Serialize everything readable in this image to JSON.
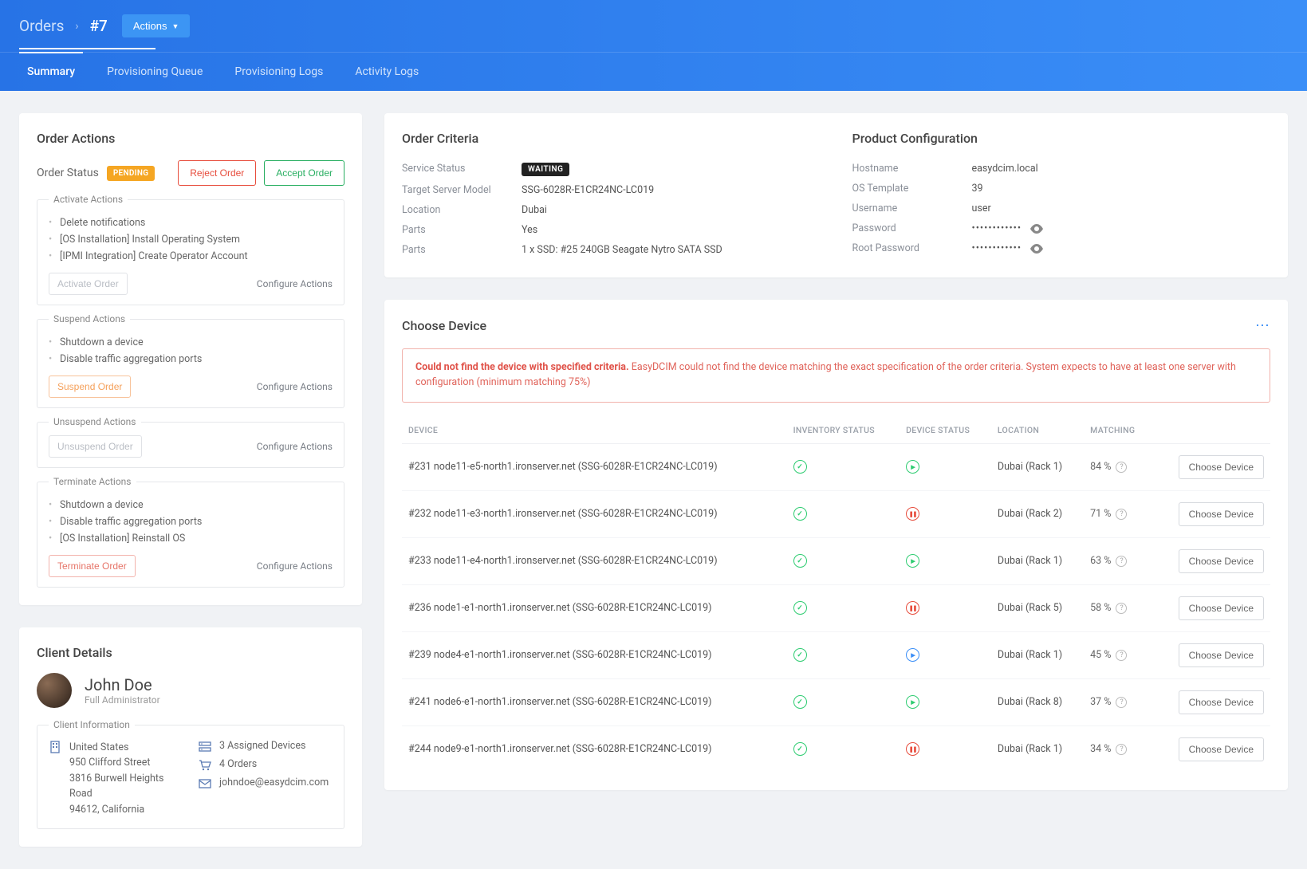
{
  "breadcrumb": {
    "root": "Orders",
    "current": "#7"
  },
  "actions_dropdown": "Actions",
  "tabs": [
    "Summary",
    "Provisioning Queue",
    "Provisioning Logs",
    "Activity Logs"
  ],
  "active_tab": 0,
  "order_actions": {
    "title": "Order Actions",
    "status_label": "Order Status",
    "status_badge": "PENDING",
    "reject_btn": "Reject Order",
    "accept_btn": "Accept Order",
    "configure_link": "Configure Actions",
    "groups": [
      {
        "legend": "Activate Actions",
        "items": [
          "Delete notifications",
          "[OS Installation] Install Operating System",
          "[IPMI Integration] Create Operator Account"
        ],
        "primary_btn": "Activate Order",
        "btn_style": "disabled"
      },
      {
        "legend": "Suspend Actions",
        "items": [
          "Shutdown a device",
          "Disable traffic aggregation ports"
        ],
        "primary_btn": "Suspend Order",
        "btn_style": "orange"
      },
      {
        "legend": "Unsuspend Actions",
        "items": [],
        "primary_btn": "Unsuspend Order",
        "btn_style": "disabled"
      },
      {
        "legend": "Terminate Actions",
        "items": [
          "Shutdown a device",
          "Disable traffic aggregation ports",
          "[OS Installation] Reinstall OS"
        ],
        "primary_btn": "Terminate Order",
        "btn_style": "red"
      }
    ]
  },
  "client": {
    "title": "Client Details",
    "name": "John Doe",
    "role": "Full Administrator",
    "info_legend": "Client Information",
    "address": [
      "United States",
      "950 Clifford Street",
      "3816 Burwell Heights Road",
      "94612, California"
    ],
    "summary": [
      {
        "icon": "server-icon",
        "text": "3 Assigned Devices"
      },
      {
        "icon": "cart-icon",
        "text": "4 Orders"
      },
      {
        "icon": "mail-icon",
        "text": "johndoe@easydcim.com"
      }
    ]
  },
  "criteria": {
    "title": "Order Criteria",
    "rows": [
      {
        "k": "Service Status",
        "v": "WAITING",
        "badge": true
      },
      {
        "k": "Target Server Model",
        "v": "SSG-6028R-E1CR24NC-LC019"
      },
      {
        "k": "Location",
        "v": "Dubai"
      },
      {
        "k": "Parts",
        "v": "Yes"
      },
      {
        "k": "Parts",
        "v": "1 x SSD: #25 240GB Seagate Nytro SATA SSD"
      }
    ]
  },
  "config": {
    "title": "Product Configuration",
    "rows": [
      {
        "k": "Hostname",
        "v": "easydcim.local"
      },
      {
        "k": "OS Template",
        "v": "39"
      },
      {
        "k": "Username",
        "v": "user"
      },
      {
        "k": "Password",
        "v": "••••••••••••",
        "eye": true
      },
      {
        "k": "Root Password",
        "v": "••••••••••••",
        "eye": true
      }
    ]
  },
  "choose": {
    "title": "Choose Device",
    "alert_bold": "Could not find the device with specified criteria.",
    "alert_rest": " EasyDCIM could not find the device matching the exact specification of the order criteria. System expects to have at least one server with configuration (minimum matching 75%)",
    "columns": [
      "DEVICE",
      "INVENTORY STATUS",
      "DEVICE STATUS",
      "LOCATION",
      "MATCHING",
      ""
    ],
    "choose_btn": "Choose Device",
    "rows": [
      {
        "device": "#231 node11-e5-north1.ironserver.net (SSG-6028R-E1CR24NC-LC019)",
        "inv": "ok",
        "dev": "play",
        "location": "Dubai (Rack 1)",
        "match": "84 %"
      },
      {
        "device": "#232 node11-e3-north1.ironserver.net (SSG-6028R-E1CR24NC-LC019)",
        "inv": "ok",
        "dev": "pause",
        "location": "Dubai (Rack 2)",
        "match": "71 %"
      },
      {
        "device": "#233 node11-e4-north1.ironserver.net (SSG-6028R-E1CR24NC-LC019)",
        "inv": "ok",
        "dev": "play",
        "location": "Dubai (Rack 1)",
        "match": "63 %"
      },
      {
        "device": "#236 node1-e1-north1.ironserver.net (SSG-6028R-E1CR24NC-LC019)",
        "inv": "ok",
        "dev": "pause",
        "location": "Dubai (Rack 5)",
        "match": "58 %"
      },
      {
        "device": "#239 node4-e1-north1.ironserver.net (SSG-6028R-E1CR24NC-LC019)",
        "inv": "ok",
        "dev": "play-blue",
        "location": "Dubai (Rack 1)",
        "match": "45 %"
      },
      {
        "device": "#241 node6-e1-north1.ironserver.net (SSG-6028R-E1CR24NC-LC019)",
        "inv": "ok",
        "dev": "play",
        "location": "Dubai (Rack 8)",
        "match": "37 %"
      },
      {
        "device": "#244 node9-e1-north1.ironserver.net (SSG-6028R-E1CR24NC-LC019)",
        "inv": "ok",
        "dev": "pause",
        "location": "Dubai (Rack 1)",
        "match": "34 %"
      }
    ]
  }
}
